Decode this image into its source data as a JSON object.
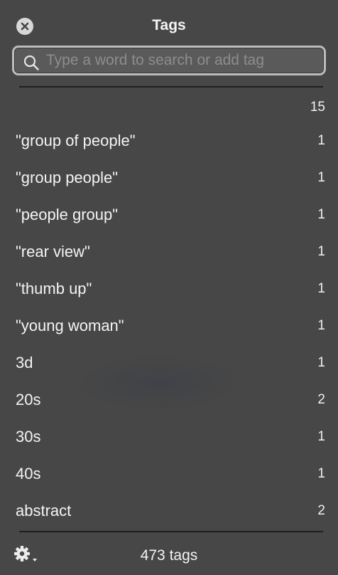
{
  "window": {
    "title": "Tags"
  },
  "search": {
    "placeholder": "Type a word to search or add tag",
    "value": ""
  },
  "summary_count": "15",
  "tags": [
    {
      "label": "\"group of people\"",
      "count": "1"
    },
    {
      "label": "\"group people\"",
      "count": "1"
    },
    {
      "label": "\"people group\"",
      "count": "1"
    },
    {
      "label": "\"rear view\"",
      "count": "1"
    },
    {
      "label": "\"thumb up\"",
      "count": "1"
    },
    {
      "label": "\"young woman\"",
      "count": "1"
    },
    {
      "label": "3d",
      "count": "1"
    },
    {
      "label": "20s",
      "count": "2"
    },
    {
      "label": "30s",
      "count": "1"
    },
    {
      "label": "40s",
      "count": "1"
    },
    {
      "label": "abstract",
      "count": "2"
    }
  ],
  "footer": {
    "total_label": "473 tags",
    "settings_icon": "gear-icon"
  },
  "colors": {
    "background": "#474747",
    "text": "#f4f4f4",
    "search_border": "#bcbcbc",
    "placeholder": "#8d8d8d"
  }
}
